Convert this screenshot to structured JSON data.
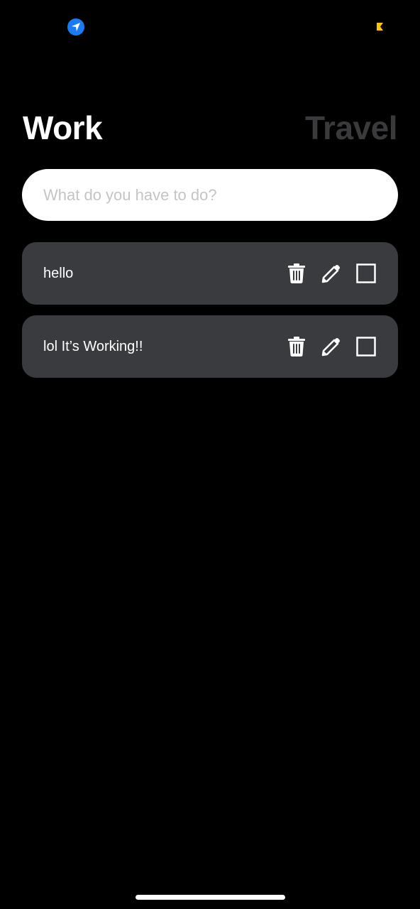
{
  "status_bar": {
    "left_icon": "location-arrow-icon",
    "right_icon": "battery-indicator-icon",
    "location_color": "#1a7cf5",
    "indicator_color": "#ffc400"
  },
  "header": {
    "tabs": [
      {
        "label": "Work",
        "active": true
      },
      {
        "label": "Travel",
        "active": false
      }
    ]
  },
  "input": {
    "placeholder": "What do you have to do?",
    "value": ""
  },
  "todos": [
    {
      "text": "hello",
      "done": false
    },
    {
      "text": "lol It’s Working!!",
      "done": false
    }
  ],
  "icons": {
    "delete": "trash-icon",
    "edit": "pencil-icon",
    "check": "checkbox-icon"
  },
  "colors": {
    "background": "#000000",
    "card": "#3a3b3e",
    "inactive_tab": "#3a3a3c"
  }
}
